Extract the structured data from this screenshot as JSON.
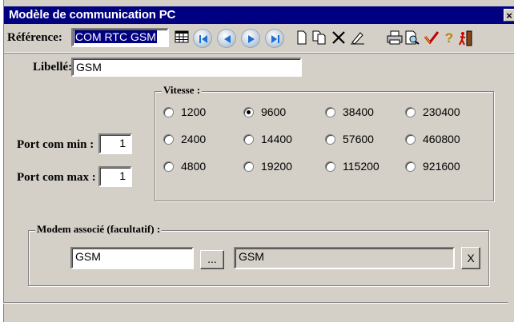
{
  "window": {
    "title": "Modèle de communication PC",
    "close_label": "×"
  },
  "toolbar": {
    "reference_label": "Référence:",
    "reference_value": "COM RTC GSM",
    "icons": [
      "table-icon",
      "first-record-icon",
      "previous-record-icon",
      "next-record-icon",
      "last-record-icon",
      "new-document-icon",
      "copy-document-icon",
      "delete-icon",
      "edit-icon",
      "print-icon",
      "print-preview-icon",
      "validate-icon",
      "help-icon",
      "exit-icon"
    ]
  },
  "form": {
    "libelle_label": "Libellé:",
    "libelle_value": "GSM",
    "port_min_label": "Port com min :",
    "port_min_value": "1",
    "port_max_label": "Port com max :",
    "port_max_value": "1"
  },
  "vitesse": {
    "legend": "Vitesse :",
    "options": [
      "1200",
      "9600",
      "38400",
      "230400",
      "2400",
      "14400",
      "57600",
      "460800",
      "4800",
      "19200",
      "115200",
      "921600"
    ],
    "selected": "9600"
  },
  "modem": {
    "legend": "Modem associé (facultatif) :",
    "code_value": "GSM",
    "browse_label": "...",
    "name_value": "GSM",
    "clear_label": "X"
  }
}
